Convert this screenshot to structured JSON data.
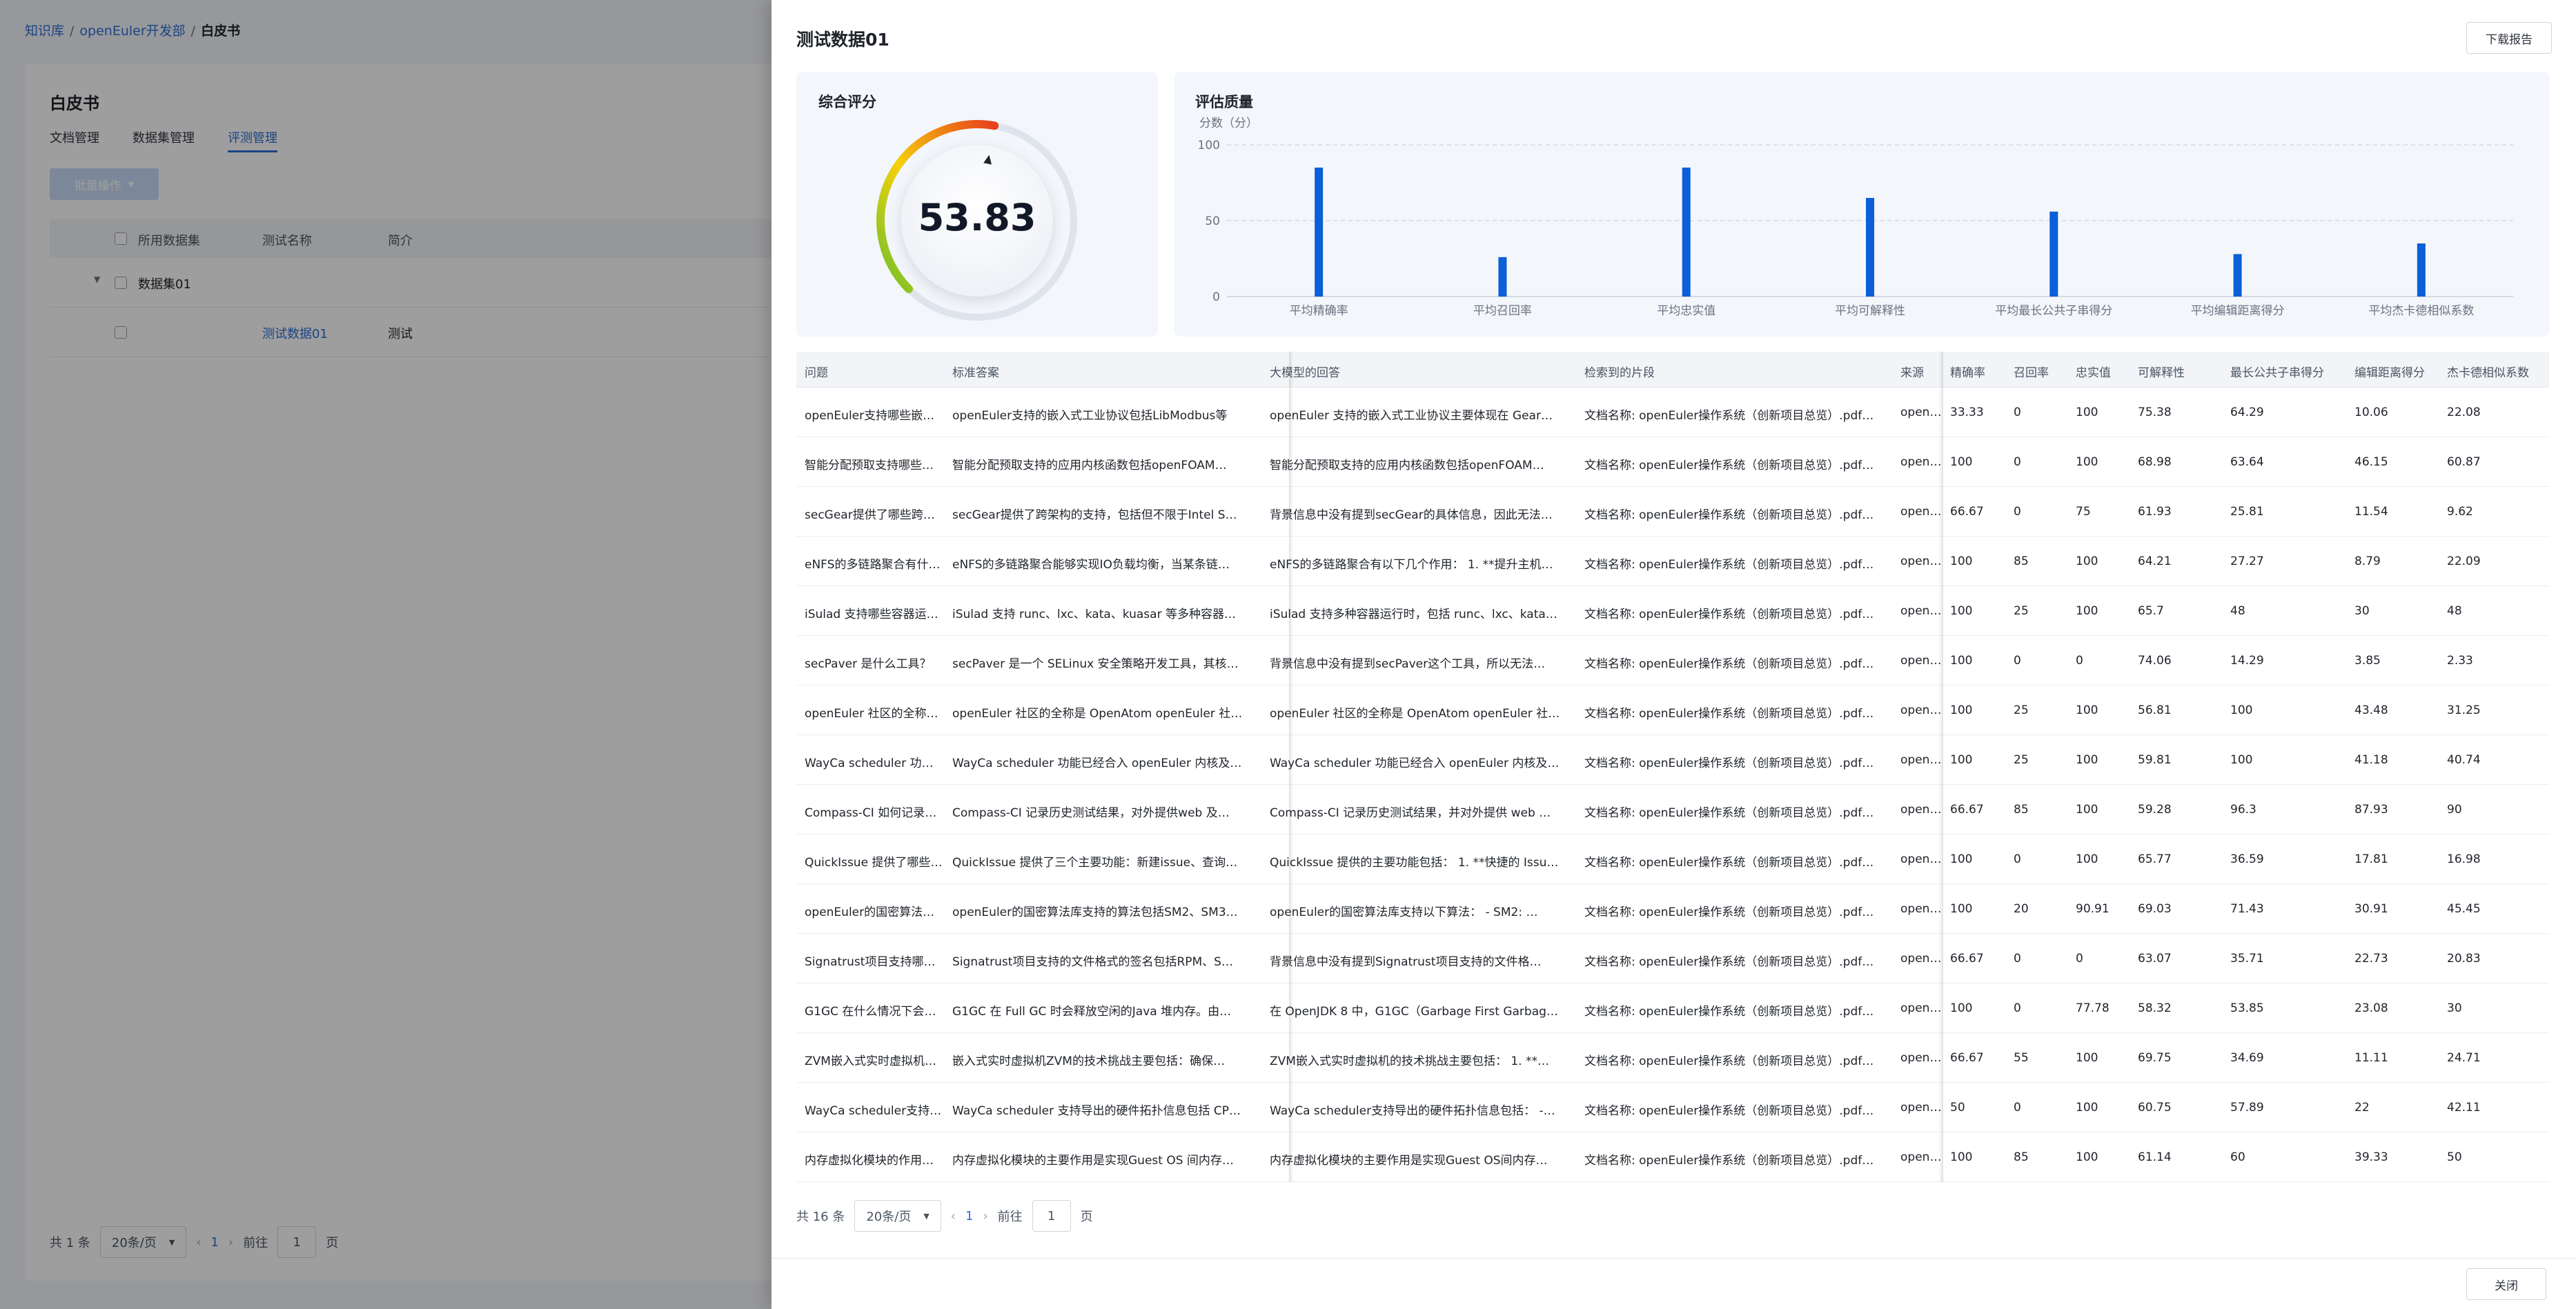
{
  "breadcrumb": {
    "root": "知识库",
    "team": "openEuler开发部",
    "current": "白皮书"
  },
  "background": {
    "title": "白皮书",
    "tabs": [
      "文档管理",
      "数据集管理",
      "评测管理"
    ],
    "bulk_button": "批量操作",
    "columns": [
      "所用数据集",
      "测试名称",
      "简介"
    ],
    "group_row": "数据集01",
    "row": {
      "name": "测试数据01",
      "desc": "测试"
    },
    "footer": {
      "total": "共 1 条",
      "page_size": "20条/页",
      "page": "1",
      "goto": "前往",
      "goto_value": "1",
      "page_unit": "页"
    }
  },
  "drawer": {
    "title": "测试数据01",
    "download_button": "下载报告",
    "close_button": "关闭",
    "overall": {
      "title": "综合评分",
      "score": "53.83",
      "score_value": 53.83,
      "max": 100
    },
    "quality": {
      "title": "评估质量"
    }
  },
  "chart_data": {
    "type": "bar",
    "title": "评估质量",
    "ylabel": "分数（分）",
    "ylim": [
      0,
      100
    ],
    "yticks": [
      "100",
      "50",
      "0"
    ],
    "grid": true,
    "categories": [
      "平均精确率",
      "平均召回率",
      "平均忠实值",
      "平均可解释性",
      "平均最长公共子串得分",
      "平均编辑距离得分",
      "平均杰卡德相似系数"
    ],
    "values": [
      85,
      26,
      85,
      65,
      56,
      28,
      35
    ],
    "color": "#0b5fd8"
  },
  "table": {
    "headers": [
      "问题",
      "标准答案",
      "大模型的回答",
      "检索到的片段",
      "来源",
      "精确率",
      "召回率",
      "忠实值",
      "可解释性",
      "最长公共子串得分",
      "编辑距离得分",
      "杰卡德相似系数"
    ],
    "rows": [
      [
        "openEuler支持哪些嵌入式工业协议？",
        "openEuler支持的嵌入式工业协议包括LibModbus等",
        "openEuler 支持的嵌入式工业协议主要体现在 Gear…",
        "文档名称: openEuler操作系统（创新项目总览）.pdf…",
        "openEuler",
        "33.33",
        "0",
        "100",
        "75.38",
        "64.29",
        "10.06",
        "22.08"
      ],
      [
        "智能分配预取支持哪些应用内核函数？",
        "智能分配预取支持的应用内核函数包括openFOAM…",
        "智能分配预取支持的应用内核函数包括openFOAM…",
        "文档名称: openEuler操作系统（创新项目总览）.pdf…",
        "openEuler",
        "100",
        "0",
        "100",
        "68.98",
        "63.64",
        "46.15",
        "60.87"
      ],
      [
        "secGear提供了哪些跨架构支持？",
        "secGear提供了跨架构的支持，包括但不限于Intel S…",
        "背景信息中没有提到secGear的具体信息，因此无法…",
        "文档名称: openEuler操作系统（创新项目总览）.pdf…",
        "openEuler",
        "66.67",
        "0",
        "75",
        "61.93",
        "25.81",
        "11.54",
        "9.62"
      ],
      [
        "eNFS的多链路聚合有什么作用？",
        "eNFS的多链路聚合能够实现IO负载均衡，当某条链…",
        "eNFS的多链路聚合有以下几个作用： 1. **提升主机…",
        "文档名称: openEuler操作系统（创新项目总览）.pdf…",
        "openEuler",
        "100",
        "85",
        "100",
        "64.21",
        "27.27",
        "8.79",
        "22.09"
      ],
      [
        "iSulad 支持哪些容器运行时？",
        "iSulad 支持 runc、lxc、kata、kuasar 等多种容器…",
        "iSulad 支持多种容器运行时，包括 runc、lxc、kata…",
        "文档名称: openEuler操作系统（创新项目总览）.pdf…",
        "openEuler",
        "100",
        "25",
        "100",
        "65.7",
        "48",
        "30",
        "48"
      ],
      [
        "secPaver 是什么工具？",
        "secPaver 是一个 SELinux 安全策略开发工具，其核…",
        "背景信息中没有提到secPaver这个工具，所以无法…",
        "文档名称: openEuler操作系统（创新项目总览）.pdf…",
        "openEuler",
        "100",
        "0",
        "0",
        "74.06",
        "14.29",
        "3.85",
        "2.33"
      ],
      [
        "openEuler 社区的全称是什么？",
        "openEuler 社区的全称是 OpenAtom openEuler 社…",
        "openEuler 社区的全称是 OpenAtom openEuler 社…",
        "文档名称: openEuler操作系统（创新项目总览）.pdf…",
        "openEuler",
        "100",
        "25",
        "100",
        "56.81",
        "100",
        "43.48",
        "31.25"
      ],
      [
        "WayCa scheduler 功能已经合入哪些内核？",
        "WayCa scheduler 功能已经合入 openEuler 内核及…",
        "WayCa scheduler 功能已经合入 openEuler 内核及…",
        "文档名称: openEuler操作系统（创新项目总览）.pdf…",
        "openEuler",
        "100",
        "25",
        "100",
        "59.81",
        "100",
        "41.18",
        "40.74"
      ],
      [
        "Compass-CI 如何记录历史测试结果？",
        "Compass-CI 记录历史测试结果，对外提供web 及…",
        "Compass-CI 记录历史测试结果，并对外提供 web …",
        "文档名称: openEuler操作系统（创新项目总览）.pdf…",
        "openEuler",
        "66.67",
        "85",
        "100",
        "59.28",
        "96.3",
        "87.93",
        "90"
      ],
      [
        "QuickIssue 提供了哪些主要功能？",
        "QuickIssue 提供了三个主要功能：新建issue、查询…",
        "QuickIssue 提供的主要功能包括： 1. **快捷的 Issu…",
        "文档名称: openEuler操作系统（创新项目总览）.pdf…",
        "openEuler",
        "100",
        "0",
        "100",
        "65.77",
        "36.59",
        "17.81",
        "16.98"
      ],
      [
        "openEuler的国密算法库支持哪些算法？",
        "openEuler的国密算法库支持的算法包括SM2、SM3…",
        "openEuler的国密算法库支持以下算法： - SM2: …",
        "文档名称: openEuler操作系统（创新项目总览）.pdf…",
        "openEuler",
        "100",
        "20",
        "90.91",
        "69.03",
        "71.43",
        "30.91",
        "45.45"
      ],
      [
        "Signatrust项目支持哪些文件格式？",
        "Signatrust项目支持的文件格式的签名包括RPM、S…",
        "背景信息中没有提到Signatrust项目支持的文件格…",
        "文档名称: openEuler操作系统（创新项目总览）.pdf…",
        "openEuler",
        "66.67",
        "0",
        "0",
        "63.07",
        "35.71",
        "22.73",
        "20.83"
      ],
      [
        "G1GC 在什么情况下会释放内存？",
        "G1GC 在 Full GC 时会释放空闲的Java 堆内存。由…",
        "在 OpenJDK 8 中，G1GC（Garbage First Garbag…",
        "文档名称: openEuler操作系统（创新项目总览）.pdf…",
        "openEuler",
        "100",
        "0",
        "77.78",
        "58.32",
        "53.85",
        "23.08",
        "30"
      ],
      [
        "ZVM嵌入式实时虚拟机的技术挑战？",
        "嵌入式实时虚拟机ZVM的技术挑战主要包括：确保…",
        "ZVM嵌入式实时虚拟机的技术挑战主要包括： 1. **…",
        "文档名称: openEuler操作系统（创新项目总览）.pdf…",
        "openEuler",
        "66.67",
        "55",
        "100",
        "69.75",
        "34.69",
        "11.11",
        "24.71"
      ],
      [
        "WayCa scheduler支持导出哪些信息？",
        "WayCa scheduler 支持导出的硬件拓扑信息包括 CP…",
        "WayCa scheduler支持导出的硬件拓扑信息包括： -…",
        "文档名称: openEuler操作系统（创新项目总览）.pdf…",
        "openEuler",
        "50",
        "0",
        "100",
        "60.75",
        "57.89",
        "22",
        "42.11"
      ],
      [
        "内存虚拟化模块的作用是什么？",
        "内存虚拟化模块的主要作用是实现Guest OS 间内存…",
        "内存虚拟化模块的主要作用是实现Guest OS间内存…",
        "文档名称: openEuler操作系统（创新项目总览）.pdf…",
        "openEuler",
        "100",
        "85",
        "100",
        "61.14",
        "60",
        "39.33",
        "50"
      ]
    ]
  },
  "pager": {
    "total": "共 16 条",
    "page_size": "20条/页",
    "page": "1",
    "goto": "前往",
    "goto_value": "1",
    "page_unit": "页"
  },
  "colors": {
    "accent": "#2b6fd6",
    "bar": "#0b5fd8",
    "gauge_start": "#6cbf2c",
    "gauge_mid": "#f5d10a",
    "gauge_end": "#e8401c"
  }
}
